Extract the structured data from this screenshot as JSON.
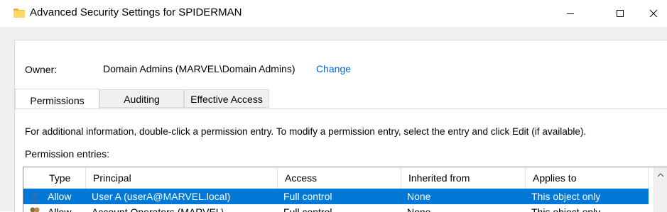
{
  "window": {
    "title": "Advanced Security Settings for SPIDERMAN",
    "icon": "folder-icon",
    "controls": [
      "minimize-icon",
      "maximize-icon",
      "close-icon"
    ]
  },
  "owner": {
    "label": "Owner:",
    "value": "Domain Admins (MARVEL\\Domain Admins)",
    "change_label": "Change"
  },
  "tabs": [
    {
      "label": "Permissions",
      "active": true
    },
    {
      "label": "Auditing",
      "active": false
    },
    {
      "label": "Effective Access",
      "active": false
    }
  ],
  "info_text": "For additional information, double-click a permission entry. To modify a permission entry, select the entry and click Edit (if available).",
  "entries_label": "Permission entries:",
  "table": {
    "columns": [
      "Type",
      "Principal",
      "Access",
      "Inherited from",
      "Applies to"
    ],
    "rows": [
      {
        "type": "Allow",
        "principal": "User A (userA@MARVEL.local)",
        "access": "Full control",
        "inherited": "None",
        "applies": "This object only",
        "selected": true
      },
      {
        "type": "Allow",
        "principal": "Account Operators (MARVEL\\...",
        "access": "Full control",
        "inherited": "None",
        "applies": "This object only",
        "selected": false
      }
    ]
  },
  "colors": {
    "accent": "#0078d7",
    "link": "#0066cc",
    "dialog_bg": "#f0f0f0"
  }
}
